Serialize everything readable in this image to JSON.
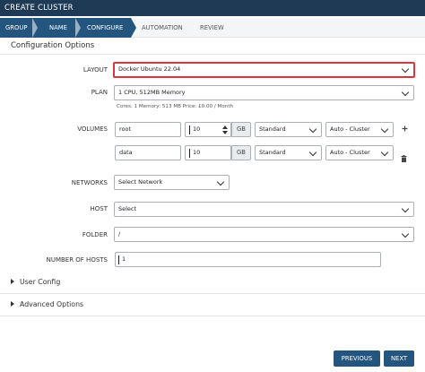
{
  "window": {
    "title": "CREATE CLUSTER"
  },
  "wizard": {
    "steps": [
      {
        "label": "GROUP"
      },
      {
        "label": "NAME"
      },
      {
        "label": "CONFIGURE"
      },
      {
        "label": "AUTOMATION"
      },
      {
        "label": "REVIEW"
      }
    ],
    "active_step": "CONFIGURE"
  },
  "section": {
    "title": "Configuration Options"
  },
  "form": {
    "layout": {
      "label": "LAYOUT",
      "value": "Docker Ubuntu 22.04"
    },
    "plan": {
      "label": "PLAN",
      "value": "1 CPU, 512MB Memory",
      "hint": "Cores: 1  Memory: 513 MB  Price: £0.00 / Month"
    },
    "volumes": {
      "label": "VOLUMES",
      "rows": [
        {
          "name": "root",
          "size": "10",
          "unit": "GB",
          "type": "Standard",
          "datastore": "Auto - Cluster"
        },
        {
          "name": "data",
          "size": "10",
          "unit": "GB",
          "type": "Standard",
          "datastore": "Auto - Cluster"
        }
      ]
    },
    "networks": {
      "label": "NETWORKS",
      "value": "Select Network"
    },
    "host": {
      "label": "HOST",
      "value": "Select"
    },
    "folder": {
      "label": "FOLDER",
      "value": "/"
    },
    "number_of_hosts": {
      "label": "NUMBER OF HOSTS",
      "value": "1"
    }
  },
  "expanders": {
    "user_config": "User Config",
    "advanced_options": "Advanced Options"
  },
  "buttons": {
    "previous": "PREVIOUS",
    "next": "NEXT"
  },
  "colors": {
    "titlebar": "#1f3a54",
    "accent": "#24557e",
    "highlight_border": "#d9363e"
  },
  "icons": {
    "add": "plus-icon",
    "delete": "trash-icon",
    "expand": "triangle-right-icon",
    "dropdown": "chevron-down-icon"
  }
}
